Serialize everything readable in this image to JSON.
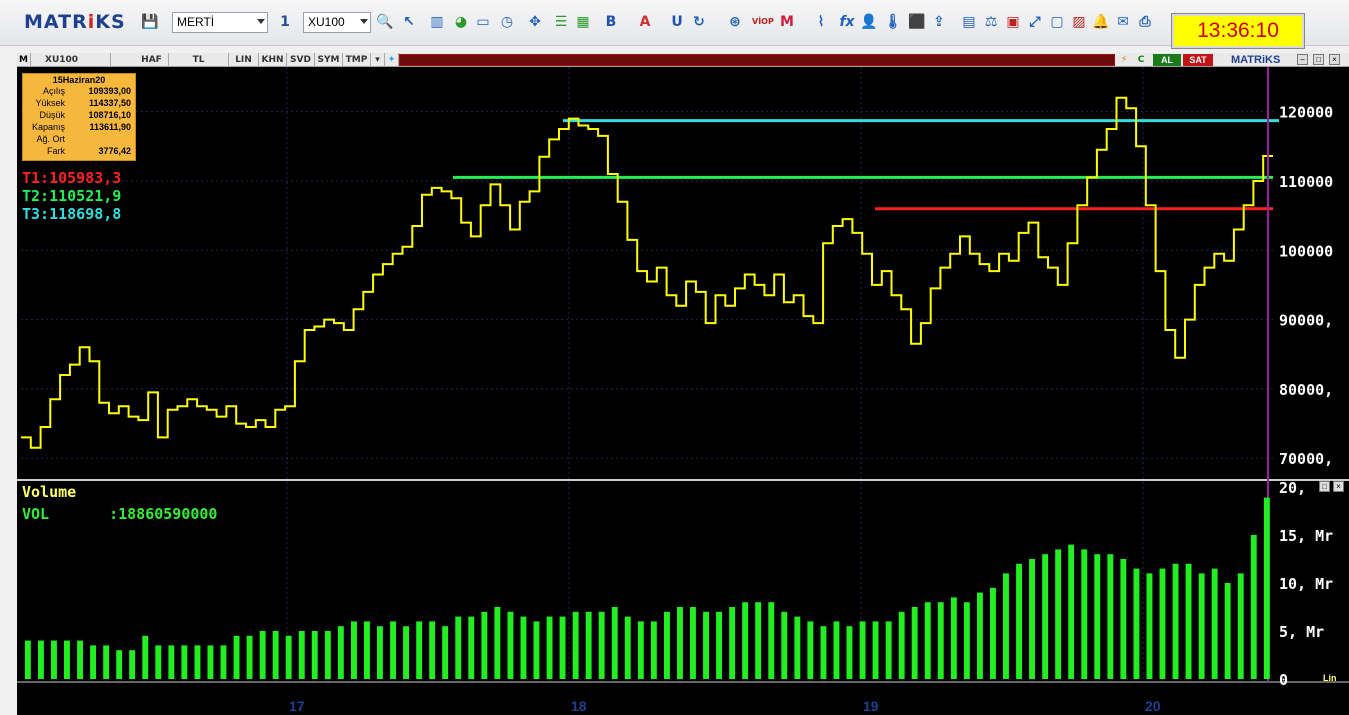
{
  "toolbar": {
    "logo_main": "MATR",
    "logo_accent": "i",
    "logo_end": "KS",
    "broker_select": "MERTİ",
    "period_select": "1",
    "symbol_select": "XU100",
    "clock": "13:36:10"
  },
  "chart_header": {
    "symbol": "XU100",
    "cells": [
      "HAF",
      "TL",
      "LIN",
      "KHN",
      "SVD",
      "SYM",
      "TMP"
    ],
    "buy_label": "AL",
    "sell_label": "SAT",
    "logo": "MATRiKS"
  },
  "ohlc": {
    "date": "15Haziran20",
    "rows": [
      {
        "label": "Açılış",
        "value": "109393,00"
      },
      {
        "label": "Yüksek",
        "value": "114337,50"
      },
      {
        "label": "Düşük",
        "value": "108716,10"
      },
      {
        "label": "Kapanış",
        "value": "113611,90"
      },
      {
        "label": "Ağ. Ort",
        "value": ""
      },
      {
        "label": "Fark",
        "value": "3776,42"
      }
    ]
  },
  "targets": {
    "t1": "T1:105983,3",
    "t2": "T2:110521,9",
    "t3": "T3:118698,8"
  },
  "volume": {
    "title": "Volume",
    "label": "VOL",
    "value": ":18860590000",
    "scale_mode": "Lin"
  },
  "colors": {
    "price": "#ffff00",
    "t1": "#ff2020",
    "t2": "#22ee55",
    "t3": "#33dddd",
    "volume": "#22ee22",
    "cursor": "#9a20a0"
  },
  "chart_data": [
    {
      "type": "line",
      "title": "",
      "series": [
        {
          "values": [
            73000,
            71500,
            74500,
            78500,
            82000,
            83500,
            86000,
            84000,
            78000,
            76500,
            77500,
            76000,
            75500,
            79500,
            73000,
            77000,
            77500,
            78500,
            77500,
            77000,
            76000,
            77500,
            75000,
            74500,
            75500,
            74500,
            77000,
            77500,
            84000,
            88500,
            89000,
            90000,
            89500,
            88500,
            91500,
            94000,
            96500,
            98000,
            99500,
            100500,
            103500,
            108000,
            109000,
            108500,
            107500,
            104000,
            102000,
            106500,
            109500,
            106500,
            103000,
            107000,
            108500,
            113500,
            116000,
            117500,
            119000,
            118000,
            117500,
            116500,
            111000,
            107000,
            101500,
            97000,
            95500,
            97500,
            93500,
            92000,
            95500,
            94000,
            89500,
            93500,
            92000,
            94500,
            96500,
            95000,
            93500,
            96500,
            92500,
            93500,
            90500,
            89500,
            101000,
            103500,
            104500,
            102500,
            99500,
            95000,
            97000,
            93500,
            91500,
            86500,
            89500,
            94500,
            97500,
            99500,
            102000,
            99500,
            98000,
            97000,
            99500,
            98500,
            102500,
            104000,
            99000,
            97500,
            95000,
            101000,
            106500,
            110500,
            114500,
            117500,
            122000,
            120500,
            115000,
            106500,
            97000,
            88500,
            84500,
            90000,
            95000,
            97500,
            99500,
            98500,
            103000,
            106500,
            110000,
            113600
          ]
        }
      ],
      "ylim": [
        67000,
        125000
      ],
      "yticks": [
        "120000",
        "110000",
        "100000",
        "90000,",
        "80000,",
        "70000,"
      ],
      "ytick_values": [
        120000,
        110000,
        100000,
        90000,
        80000,
        70000
      ],
      "xlabels": [
        "17",
        "18",
        "19",
        "20"
      ],
      "hlines": [
        {
          "name": "T1",
          "value": 105983.3
        },
        {
          "name": "T2",
          "value": 110521.9
        },
        {
          "name": "T3",
          "value": 118698.8
        }
      ]
    },
    {
      "type": "bar",
      "title": "Volume",
      "series": [
        {
          "name": "VOL",
          "values": [
            4,
            4,
            4,
            4,
            4,
            3.5,
            3.5,
            3,
            3,
            4.5,
            3.5,
            3.5,
            3.5,
            3.5,
            3.5,
            3.5,
            4.5,
            4.5,
            5,
            5,
            4.5,
            5,
            5,
            5,
            5.5,
            6,
            6,
            5.5,
            6,
            5.5,
            6,
            6,
            5.5,
            6.5,
            6.5,
            7,
            7.5,
            7,
            6.5,
            6,
            6.5,
            6.5,
            7,
            7,
            7,
            7.5,
            6.5,
            6,
            6,
            7,
            7.5,
            7.5,
            7,
            7,
            7.5,
            8,
            8,
            8,
            7,
            6.5,
            6,
            5.5,
            6,
            5.5,
            6,
            6,
            6,
            7,
            7.5,
            8,
            8,
            8.5,
            8,
            9,
            9.5,
            11,
            12,
            12.5,
            13,
            13.5,
            14,
            13.5,
            13,
            13,
            12.5,
            11.5,
            11,
            11.5,
            12,
            12,
            11,
            11.5,
            10,
            11,
            15,
            18.9
          ]
        }
      ],
      "ylim": [
        0,
        20
      ],
      "yticks": [
        "20,",
        "15, Mr",
        "10, Mr",
        "5, Mr",
        "0"
      ],
      "ytick_values": [
        20,
        15,
        10,
        5,
        0
      ]
    }
  ]
}
